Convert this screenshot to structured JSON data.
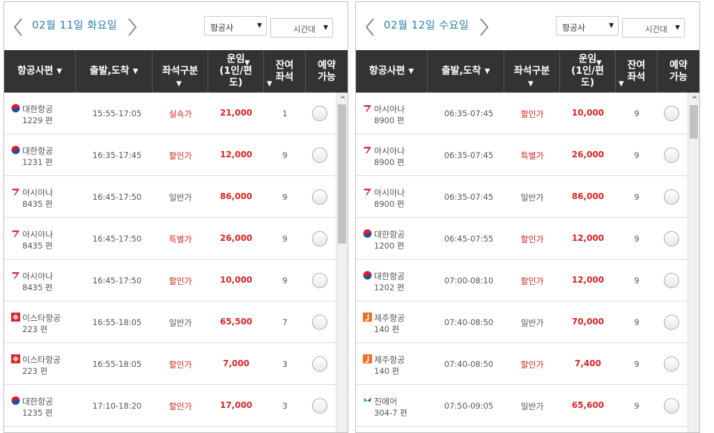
{
  "panels": [
    {
      "date": "02월 11일 화요일",
      "airline_select": "항공사",
      "time_select": "시간대",
      "headers": [
        "항공사편",
        "출발,도착",
        "좌석구분",
        "운임\n(1인/편\n도)",
        "잔여\n좌석",
        "예약\n가능"
      ],
      "rows": [
        {
          "airline": "대한항공",
          "logo": "korean-air",
          "flight": "1229 편",
          "time": "15:55-17:05",
          "seat": "실속가",
          "seat_red": true,
          "fare": "21,000",
          "left": "1"
        },
        {
          "airline": "대한항공",
          "logo": "korean-air",
          "flight": "1231 편",
          "time": "16:35-17:45",
          "seat": "할인가",
          "seat_red": true,
          "fare": "12,000",
          "left": "9"
        },
        {
          "airline": "아시아나",
          "logo": "asiana",
          "flight": "8435 편",
          "time": "16:45-17:50",
          "seat": "일반가",
          "seat_red": false,
          "fare": "86,000",
          "left": "9"
        },
        {
          "airline": "아시아나",
          "logo": "asiana",
          "flight": "8435 편",
          "time": "16:45-17:50",
          "seat": "특별가",
          "seat_red": true,
          "fare": "26,000",
          "left": "9"
        },
        {
          "airline": "아시아나",
          "logo": "asiana",
          "flight": "8435 편",
          "time": "16:45-17:50",
          "seat": "할인가",
          "seat_red": true,
          "fare": "10,000",
          "left": "9"
        },
        {
          "airline": "이스타항공",
          "logo": "eastar",
          "flight": "223 편",
          "time": "16:55-18:05",
          "seat": "일반가",
          "seat_red": false,
          "fare": "65,500",
          "left": "7"
        },
        {
          "airline": "이스타항공",
          "logo": "eastar",
          "flight": "223 편",
          "time": "16:55-18:05",
          "seat": "할인가",
          "seat_red": true,
          "fare": "7,000",
          "left": "3"
        },
        {
          "airline": "대한항공",
          "logo": "korean-air",
          "flight": "1235 편",
          "time": "17:10-18:20",
          "seat": "할인가",
          "seat_red": true,
          "fare": "17,000",
          "left": "3"
        }
      ]
    },
    {
      "date": "02월 12일 수요일",
      "airline_select": "항공사",
      "time_select": "시간대",
      "headers": [
        "항공사편",
        "출발,도착",
        "좌석구분",
        "운임\n(1인/편\n도)",
        "잔여\n좌석",
        "예약\n가능"
      ],
      "rows": [
        {
          "airline": "아시아나",
          "logo": "asiana",
          "flight": "8900 편",
          "time": "06:35-07:45",
          "seat": "할인가",
          "seat_red": true,
          "fare": "10,000",
          "left": "9"
        },
        {
          "airline": "아시아나",
          "logo": "asiana",
          "flight": "8900 편",
          "time": "06:35-07:45",
          "seat": "특별가",
          "seat_red": true,
          "fare": "26,000",
          "left": "9"
        },
        {
          "airline": "아시아나",
          "logo": "asiana",
          "flight": "8900 편",
          "time": "06:35-07:45",
          "seat": "일반가",
          "seat_red": false,
          "fare": "86,000",
          "left": "9"
        },
        {
          "airline": "대한항공",
          "logo": "korean-air",
          "flight": "1200 편",
          "time": "06:45-07:55",
          "seat": "할인가",
          "seat_red": true,
          "fare": "12,000",
          "left": "9"
        },
        {
          "airline": "대한항공",
          "logo": "korean-air",
          "flight": "1202 편",
          "time": "07:00-08:10",
          "seat": "할인가",
          "seat_red": true,
          "fare": "12,000",
          "left": "9"
        },
        {
          "airline": "제주항공",
          "logo": "jeju-air",
          "flight": "140 편",
          "time": "07:40-08:50",
          "seat": "일반가",
          "seat_red": false,
          "fare": "70,000",
          "left": "9"
        },
        {
          "airline": "제주항공",
          "logo": "jeju-air",
          "flight": "140 편",
          "time": "07:40-08:50",
          "seat": "할인가",
          "seat_red": true,
          "fare": "7,400",
          "left": "9"
        },
        {
          "airline": "진에어",
          "logo": "jin-air",
          "flight": "304-7 편",
          "time": "07:50-09:05",
          "seat": "일반가",
          "seat_red": false,
          "fare": "65,600",
          "left": "9"
        }
      ]
    }
  ],
  "colors": {
    "accent_blue": "#2a7fa6",
    "header_bg": "#333333",
    "fare_red": "#dd2222"
  }
}
